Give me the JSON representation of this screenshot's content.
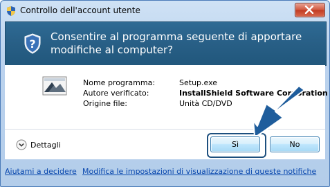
{
  "window": {
    "title": "Controllo dell'account utente"
  },
  "header": {
    "message": "Consentire al programma seguente di apportare modifiche al computer?"
  },
  "program": {
    "labels": [
      "Nome programma:",
      "Autore verificato:",
      "Origine file:"
    ],
    "values": [
      "Setup.exe",
      "InstallShield Software Corporation",
      "Unità CD/DVD"
    ]
  },
  "buttons": {
    "details_label": "Dettagli",
    "yes_label": "Sì",
    "no_label": "No"
  },
  "footer": {
    "help_link": "Aiutami a decidere",
    "settings_link": "Modifica le impostazioni di visualizzazione di queste notifiche"
  },
  "colors": {
    "header_bg": "#285f86",
    "arrow": "#1f5d9c",
    "link": "#0645ad"
  },
  "icons": [
    "uac-shield-icon",
    "close-icon",
    "question-shield-icon",
    "program-icon",
    "chevron-down-icon",
    "pointer-arrow-icon"
  ]
}
